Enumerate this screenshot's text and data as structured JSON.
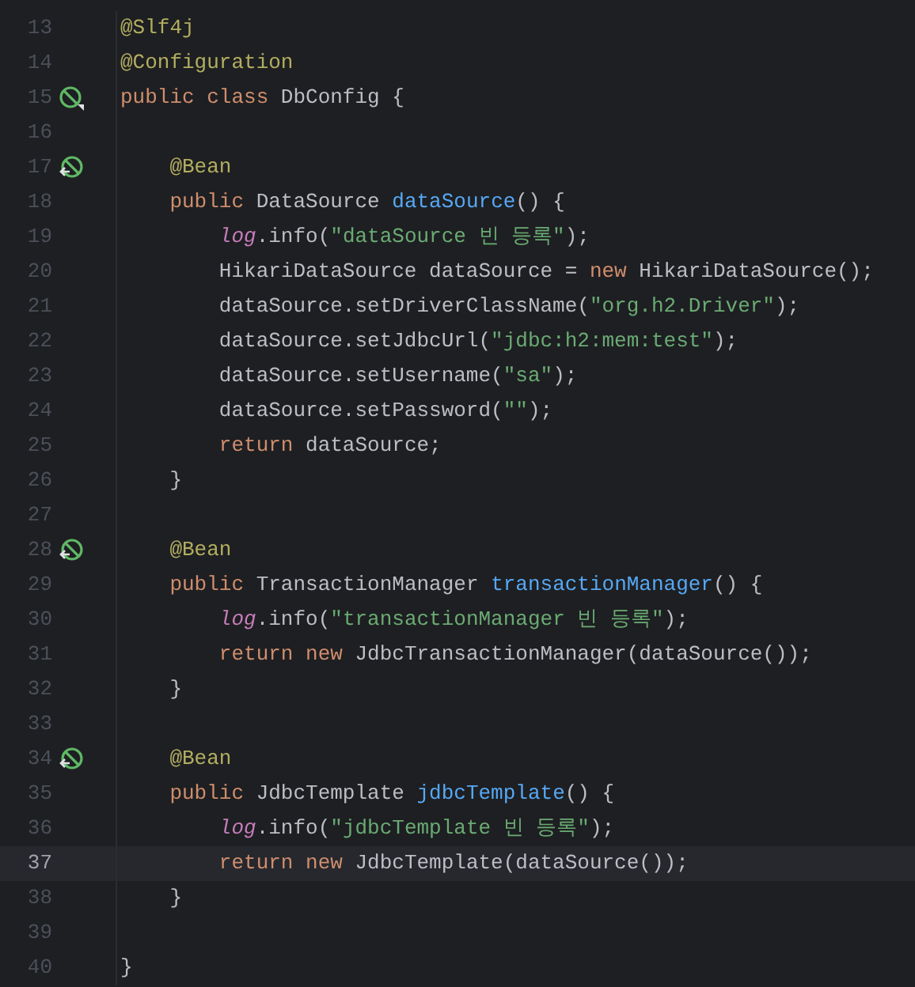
{
  "editor": {
    "lines": [
      {
        "number": "13",
        "current": false,
        "tokens": [
          {
            "kind": "annotation",
            "text": "@Slf4j"
          }
        ]
      },
      {
        "number": "14",
        "current": false,
        "tokens": [
          {
            "kind": "annotation",
            "text": "@Configuration"
          }
        ]
      },
      {
        "number": "15",
        "current": false,
        "gutter_icon": {
          "kind": "bean_class"
        },
        "tokens": [
          {
            "kind": "keyword",
            "text": "public class "
          },
          {
            "kind": "plain",
            "text": "DbConfig {"
          }
        ]
      },
      {
        "number": "16",
        "current": false
      },
      {
        "number": "17",
        "current": false,
        "gutter_icon": {
          "kind": "bean_method"
        },
        "tokens": [
          {
            "kind": "annotation",
            "text": "    @Bean"
          }
        ]
      },
      {
        "number": "18",
        "current": false,
        "tokens": [
          {
            "kind": "keyword",
            "text": "    public "
          },
          {
            "kind": "plain",
            "text": "DataSource "
          },
          {
            "kind": "method",
            "text": "dataSource"
          },
          {
            "kind": "plain",
            "text": "() {"
          }
        ]
      },
      {
        "number": "19",
        "current": false,
        "tokens": [
          {
            "kind": "field",
            "text": "        log"
          },
          {
            "kind": "plain",
            "text": ".info("
          },
          {
            "kind": "string",
            "text": "\"dataSource 빈 등록\""
          },
          {
            "kind": "plain",
            "text": ");"
          }
        ]
      },
      {
        "number": "20",
        "current": false,
        "tokens": [
          {
            "kind": "plain",
            "text": "        HikariDataSource dataSource = "
          },
          {
            "kind": "keyword",
            "text": "new "
          },
          {
            "kind": "plain",
            "text": "HikariDataSource();"
          }
        ]
      },
      {
        "number": "21",
        "current": false,
        "tokens": [
          {
            "kind": "plain",
            "text": "        dataSource.setDriverClassName("
          },
          {
            "kind": "string",
            "text": "\"org.h2.Driver\""
          },
          {
            "kind": "plain",
            "text": ");"
          }
        ]
      },
      {
        "number": "22",
        "current": false,
        "tokens": [
          {
            "kind": "plain",
            "text": "        dataSource.setJdbcUrl("
          },
          {
            "kind": "string",
            "text": "\"jdbc:h2:mem:test\""
          },
          {
            "kind": "plain",
            "text": ");"
          }
        ]
      },
      {
        "number": "23",
        "current": false,
        "tokens": [
          {
            "kind": "plain",
            "text": "        dataSource.setUsername("
          },
          {
            "kind": "string",
            "text": "\"sa\""
          },
          {
            "kind": "plain",
            "text": ");"
          }
        ]
      },
      {
        "number": "24",
        "current": false,
        "tokens": [
          {
            "kind": "plain",
            "text": "        dataSource.setPassword("
          },
          {
            "kind": "string",
            "text": "\"\""
          },
          {
            "kind": "plain",
            "text": ");"
          }
        ]
      },
      {
        "number": "25",
        "current": false,
        "tokens": [
          {
            "kind": "keyword",
            "text": "        return "
          },
          {
            "kind": "plain",
            "text": "dataSource;"
          }
        ]
      },
      {
        "number": "26",
        "current": false,
        "tokens": [
          {
            "kind": "plain",
            "text": "    }"
          }
        ]
      },
      {
        "number": "27",
        "current": false
      },
      {
        "number": "28",
        "current": false,
        "gutter_icon": {
          "kind": "bean_method"
        },
        "tokens": [
          {
            "kind": "annotation",
            "text": "    @Bean"
          }
        ]
      },
      {
        "number": "29",
        "current": false,
        "tokens": [
          {
            "kind": "keyword",
            "text": "    public "
          },
          {
            "kind": "plain",
            "text": "TransactionManager "
          },
          {
            "kind": "method",
            "text": "transactionManager"
          },
          {
            "kind": "plain",
            "text": "() {"
          }
        ]
      },
      {
        "number": "30",
        "current": false,
        "tokens": [
          {
            "kind": "field",
            "text": "        log"
          },
          {
            "kind": "plain",
            "text": ".info("
          },
          {
            "kind": "string",
            "text": "\"transactionManager 빈 등록\""
          },
          {
            "kind": "plain",
            "text": ");"
          }
        ]
      },
      {
        "number": "31",
        "current": false,
        "tokens": [
          {
            "kind": "keyword",
            "text": "        return new "
          },
          {
            "kind": "plain",
            "text": "JdbcTransactionManager(dataSource());"
          }
        ]
      },
      {
        "number": "32",
        "current": false,
        "tokens": [
          {
            "kind": "plain",
            "text": "    }"
          }
        ]
      },
      {
        "number": "33",
        "current": false
      },
      {
        "number": "34",
        "current": false,
        "gutter_icon": {
          "kind": "bean_method"
        },
        "tokens": [
          {
            "kind": "annotation",
            "text": "    @Bean"
          }
        ]
      },
      {
        "number": "35",
        "current": false,
        "tokens": [
          {
            "kind": "keyword",
            "text": "    public "
          },
          {
            "kind": "plain",
            "text": "JdbcTemplate "
          },
          {
            "kind": "method",
            "text": "jdbcTemplate"
          },
          {
            "kind": "plain",
            "text": "() {"
          }
        ]
      },
      {
        "number": "36",
        "current": false,
        "tokens": [
          {
            "kind": "field",
            "text": "        log"
          },
          {
            "kind": "plain",
            "text": ".info("
          },
          {
            "kind": "string",
            "text": "\"jdbcTemplate 빈 등록\""
          },
          {
            "kind": "plain",
            "text": ");"
          }
        ]
      },
      {
        "number": "37",
        "current": true,
        "tokens": [
          {
            "kind": "keyword",
            "text": "        return new "
          },
          {
            "kind": "plain",
            "text": "JdbcTemplate(dataSource());"
          }
        ]
      },
      {
        "number": "38",
        "current": false,
        "tokens": [
          {
            "kind": "plain",
            "text": "    }"
          }
        ]
      },
      {
        "number": "39",
        "current": false
      },
      {
        "number": "40",
        "current": false,
        "tokens": [
          {
            "kind": "plain",
            "text": "}"
          }
        ]
      }
    ]
  }
}
